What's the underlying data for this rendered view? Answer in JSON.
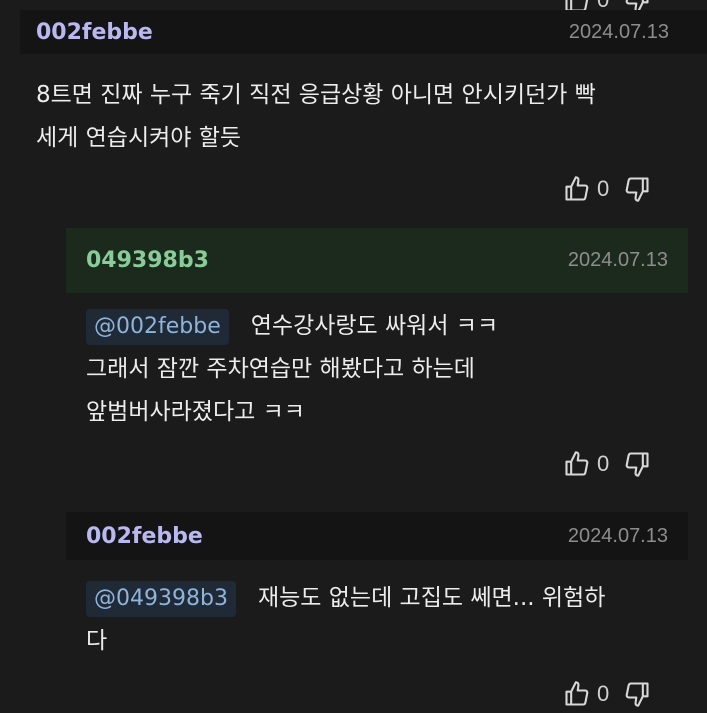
{
  "top_vote": {
    "like_count": "0"
  },
  "comments": [
    {
      "author": "002febbe",
      "date": "2024.07.13",
      "lines": [
        "8트면 진짜 누구 죽기 직전 응급상황 아니면 안시키던가 빡",
        "세게 연습시켜야 할듯"
      ],
      "like_count": "0"
    },
    {
      "author": "049398b3",
      "date": "2024.07.13",
      "mention": "@002febbe",
      "lines": [
        "연수강사랑도 싸워서 ㅋㅋ",
        "그래서 잠깐 주차연습만 해봤다고 하는데",
        "앞범버사라졌다고 ㅋㅋ"
      ],
      "like_count": "0"
    },
    {
      "author": "002febbe",
      "date": "2024.07.13",
      "mention": "@049398b3",
      "lines": [
        "재능도 없는데 고집도 쎄면... 위험하",
        "다"
      ],
      "like_count": "0"
    }
  ],
  "colors": {
    "background": "#1b1b1b",
    "header_bar_dark": "#141414",
    "reply_header_green": "#1c2a1e",
    "author_purple": "#b9b8f0",
    "author_green": "#88cc98",
    "mention_bg": "#1f2a36",
    "mention_text": "#8fb4dc"
  },
  "icons": {
    "like": "thumbs-up-icon",
    "dislike": "thumbs-down-icon"
  }
}
